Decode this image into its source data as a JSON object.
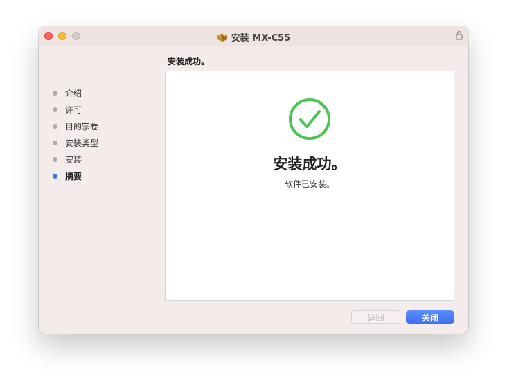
{
  "window": {
    "title": "安装 MX-C55",
    "heading": "安装成功。"
  },
  "sidebar": {
    "steps": [
      {
        "label": "介绍",
        "active": false
      },
      {
        "label": "许可",
        "active": false
      },
      {
        "label": "目的宗卷",
        "active": false
      },
      {
        "label": "安装类型",
        "active": false
      },
      {
        "label": "安装",
        "active": false
      },
      {
        "label": "摘要",
        "active": true
      }
    ]
  },
  "content": {
    "title": "安装成功。",
    "subtitle": "软件已安装。"
  },
  "buttons": {
    "back_label": "返回",
    "back_enabled": false,
    "close_label": "关闭"
  },
  "icons": {
    "title_icon": "package-icon",
    "status_icon": "checkmark-circle-icon",
    "lock_icon": "lock-icon"
  },
  "colors": {
    "success": "#4cc451",
    "accent": "#3b6fe8",
    "close_red": "#ff5f57",
    "minimize_yellow": "#febc2e"
  }
}
